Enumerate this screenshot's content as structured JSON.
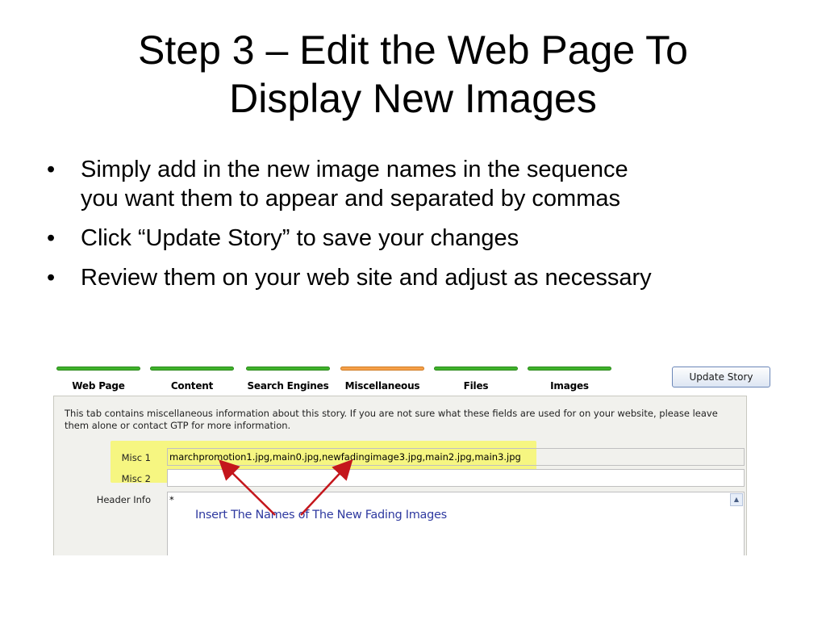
{
  "slide": {
    "title_line1": "Step 3 – Edit the Web Page To",
    "title_line2": "Display New Images",
    "bullet_glyph": "•",
    "bullets": [
      {
        "line1": "Simply add in the new image names in the sequence",
        "line2": "you want them to appear and separated by commas"
      },
      {
        "line1": "Click “Update Story” to save your changes"
      },
      {
        "line1": "Review them on your web site and adjust as necessary"
      }
    ]
  },
  "cms": {
    "tabs": [
      {
        "label": "Web Page"
      },
      {
        "label": "Content"
      },
      {
        "label": "Search Engines"
      },
      {
        "label": "Miscellaneous"
      },
      {
        "label": "Files"
      },
      {
        "label": "Images"
      }
    ],
    "active_tab": "Miscellaneous",
    "update_button_label": "Update Story",
    "info_text": "This tab contains miscellaneous information about this story. If you are not sure what these fields are used for on your website, please leave them alone or contact GTP for more information.",
    "fields": {
      "misc1": {
        "label": "Misc 1",
        "value": "marchpromotion1.jpg,main0.jpg,newfadingimage3.jpg,main2.jpg,main3.jpg"
      },
      "misc2": {
        "label": "Misc 2",
        "value": ""
      },
      "header_info": {
        "label": "Header Info",
        "value": "*"
      }
    },
    "annotation_text": "Insert The Names of The New Fading Images",
    "colors": {
      "tab_bar": "#3fb22b",
      "tab_bar_active": "#f5a04a",
      "highlight": "#fafa28",
      "arrow": "#c4161c",
      "annotation": "#2f3aa0"
    },
    "icons": {
      "scroll_up": "scroll-up-arrow-icon"
    }
  }
}
